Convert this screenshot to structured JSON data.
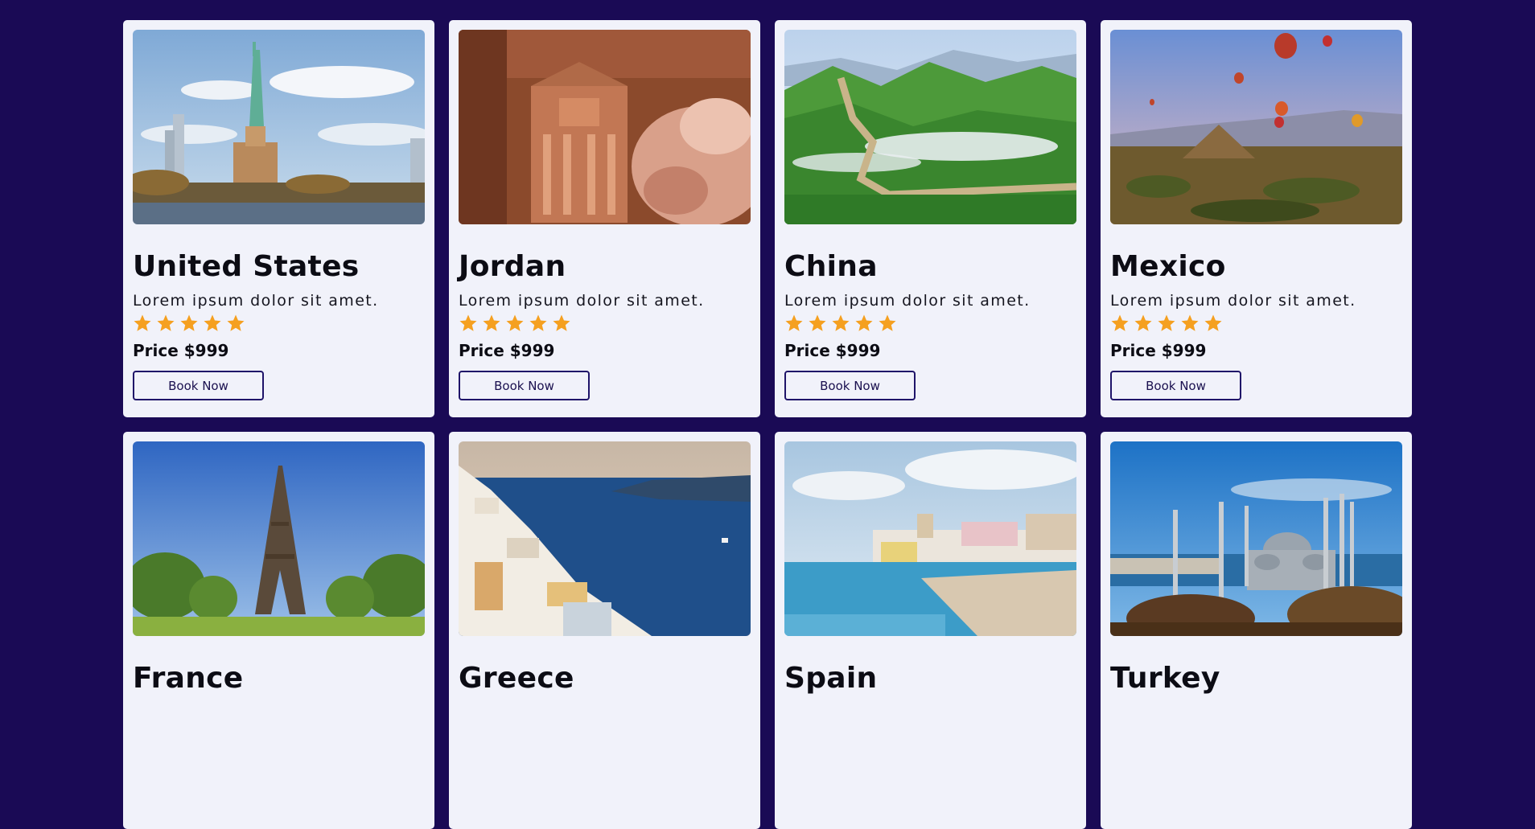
{
  "colors": {
    "page_bg": "#1a0a55",
    "card_bg": "#f1f2fa",
    "star": "#f5a020",
    "button_border": "#1f1469"
  },
  "cards": [
    {
      "country": "United States",
      "description": "Lorem ipsum dolor sit amet.",
      "rating": 5,
      "price": "Price $999",
      "button": "Book Now",
      "image": "statue-of-liberty-photo"
    },
    {
      "country": "Jordan",
      "description": "Lorem ipsum dolor sit amet.",
      "rating": 5,
      "price": "Price $999",
      "button": "Book Now",
      "image": "petra-treasury-photo"
    },
    {
      "country": "China",
      "description": "Lorem ipsum dolor sit amet.",
      "rating": 5,
      "price": "Price $999",
      "button": "Book Now",
      "image": "great-wall-photo"
    },
    {
      "country": "Mexico",
      "description": "Lorem ipsum dolor sit amet.",
      "rating": 5,
      "price": "Price $999",
      "button": "Book Now",
      "image": "teotihuacan-balloons-photo"
    },
    {
      "country": "France",
      "image": "eiffel-tower-photo"
    },
    {
      "country": "Greece",
      "image": "santorini-photo"
    },
    {
      "country": "Spain",
      "image": "beach-town-photo"
    },
    {
      "country": "Turkey",
      "image": "blue-mosque-photo"
    }
  ]
}
